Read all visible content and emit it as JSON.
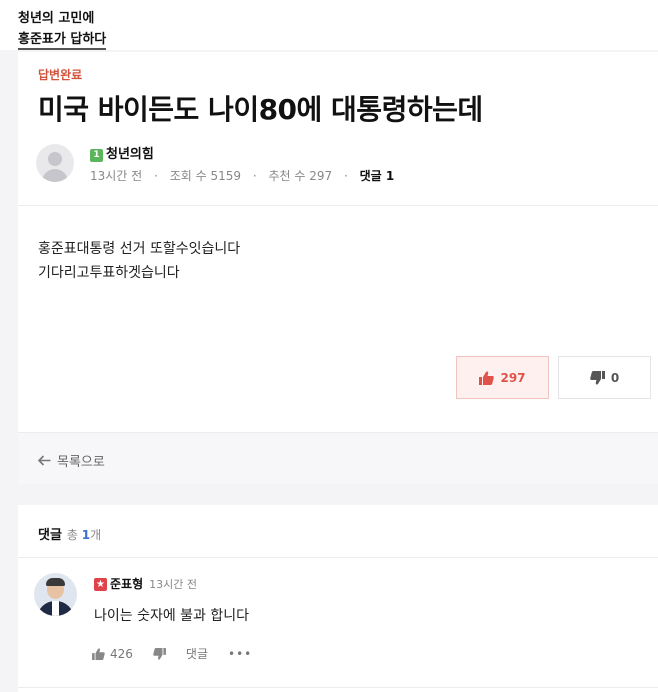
{
  "brand": {
    "line1": "청년의 고민에",
    "line2": "홍준표가 답하다"
  },
  "post": {
    "status": "답변완료",
    "title": "미국 바이든도 나이80에 대통령하는데",
    "author": {
      "badge": "1",
      "name": "청년의힘",
      "badge_color": "#5bb55b"
    },
    "meta": {
      "time": "13시간 전",
      "views": "조회 수 5159",
      "recommend": "추천 수 297",
      "comments": "댓글 1"
    },
    "body": [
      "홍준표대통령 선거 또할수잇습니다",
      "기다리고투표하겟습니다"
    ],
    "votes": {
      "up": "297",
      "down": "0"
    },
    "back_label": "목록으로"
  },
  "comments": {
    "title": "댓글",
    "total_prefix": "총 ",
    "total_count": "1",
    "total_suffix": "개",
    "items": [
      {
        "author": "준표형",
        "badge_color": "#e0424a",
        "time": "13시간 전",
        "text": "나이는 숫자에 불과 합니다",
        "likes": "426",
        "reply_label": "댓글",
        "more": "•••"
      }
    ]
  },
  "colors": {
    "accent_red": "#e0534b",
    "status_red": "#d3543c",
    "link_blue": "#3b6fd4"
  },
  "icons": [
    "thumbs-up-icon",
    "thumbs-down-icon",
    "arrow-left-icon",
    "star-badge-icon",
    "more-icon"
  ]
}
